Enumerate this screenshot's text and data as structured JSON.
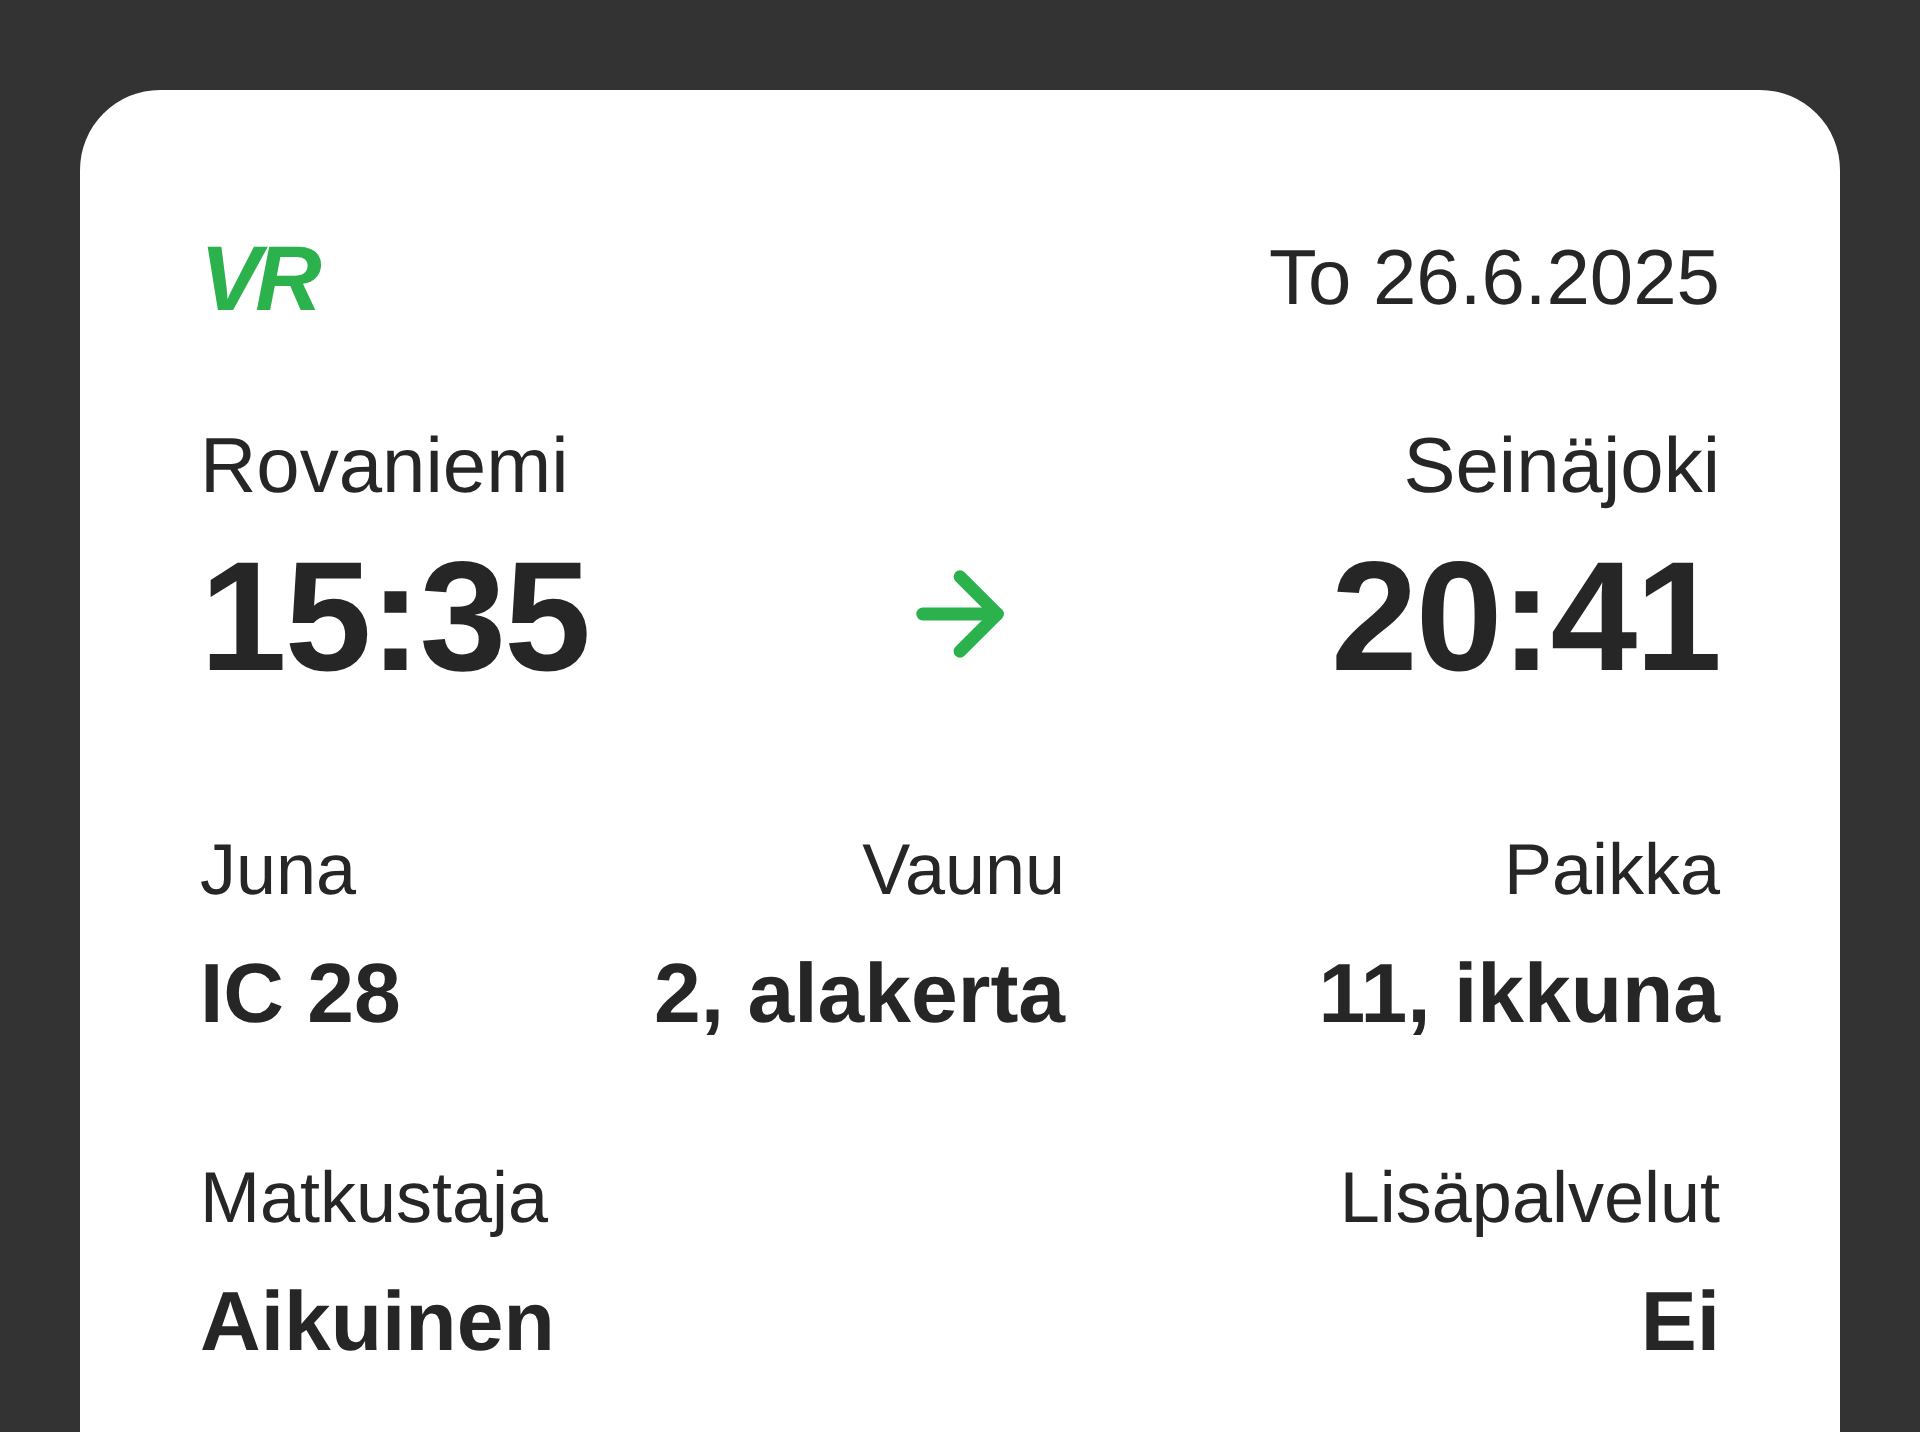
{
  "logo": "VR",
  "date": "To 26.6.2025",
  "route": {
    "from": {
      "station": "Rovaniemi",
      "time": "15:35"
    },
    "to": {
      "station": "Seinäjoki",
      "time": "20:41"
    }
  },
  "details": [
    {
      "fields": [
        {
          "label": "Juna",
          "value": "IC 28"
        },
        {
          "label": "Vaunu",
          "value": "2, alakerta"
        },
        {
          "label": "Paikka",
          "value": "11, ikkuna"
        }
      ]
    },
    {
      "fields": [
        {
          "label": "Matkustaja",
          "value": "Aikuinen"
        },
        {
          "label": "Lisäpalvelut",
          "value": "Ei"
        }
      ]
    }
  ]
}
